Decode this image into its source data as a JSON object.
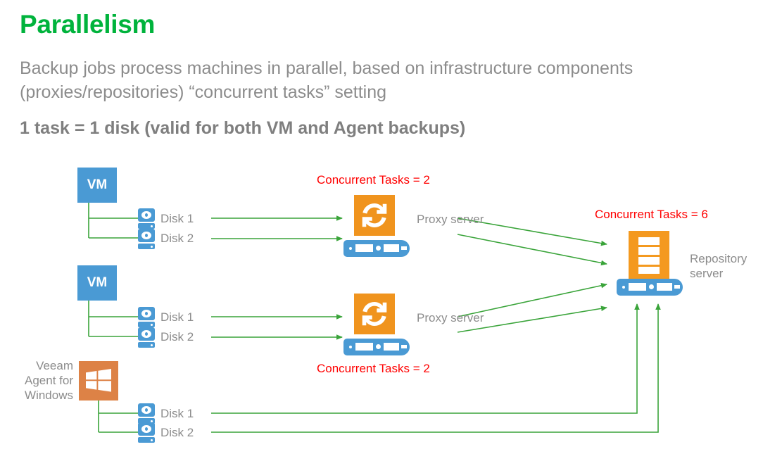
{
  "slide": {
    "title": "Parallelism",
    "subtitle": "Backup jobs process machines in parallel, based on infrastructure components (proxies/repositories) “concurrent tasks” setting",
    "tagline": "1 task = 1 disk (valid for both VM and Agent backups)",
    "colors": {
      "title_green": "#00b33c",
      "body_gray": "#8c8c8c",
      "accent_red": "#ff0000",
      "node_blue": "#4a9ad4",
      "node_orange": "#f0941e",
      "windows_orange": "#dd8246",
      "line_green": "#3aa43a"
    }
  },
  "diagram": {
    "sources": [
      {
        "id": "vm-1",
        "label": "VM",
        "type": "vm",
        "disks": [
          {
            "label": "Disk 1"
          },
          {
            "label": "Disk 2"
          }
        ]
      },
      {
        "id": "vm-2",
        "label": "VM",
        "type": "vm",
        "disks": [
          {
            "label": "Disk 1"
          },
          {
            "label": "Disk 2"
          }
        ]
      },
      {
        "id": "agent-windows",
        "label": "Veeam Agent for Windows",
        "type": "windows",
        "disks": [
          {
            "label": "Disk 1"
          },
          {
            "label": "Disk 2"
          }
        ]
      }
    ],
    "proxies": [
      {
        "id": "proxy-1",
        "label": "Proxy server",
        "tasks_label": "Concurrent Tasks = 2",
        "tasks_value": 2
      },
      {
        "id": "proxy-2",
        "label": "Proxy server",
        "tasks_label": "Concurrent Tasks = 2",
        "tasks_value": 2
      }
    ],
    "repository": {
      "id": "repository-1",
      "label": "Repository server",
      "tasks_label": "Concurrent Tasks = 6",
      "tasks_value": 6
    },
    "icons": {
      "proxy": "sync-arrows-icon",
      "repository": "storage-stack-icon",
      "disk": "hard-disk-icon",
      "windows": "windows-logo-icon",
      "server": "server-rack-icon"
    }
  }
}
